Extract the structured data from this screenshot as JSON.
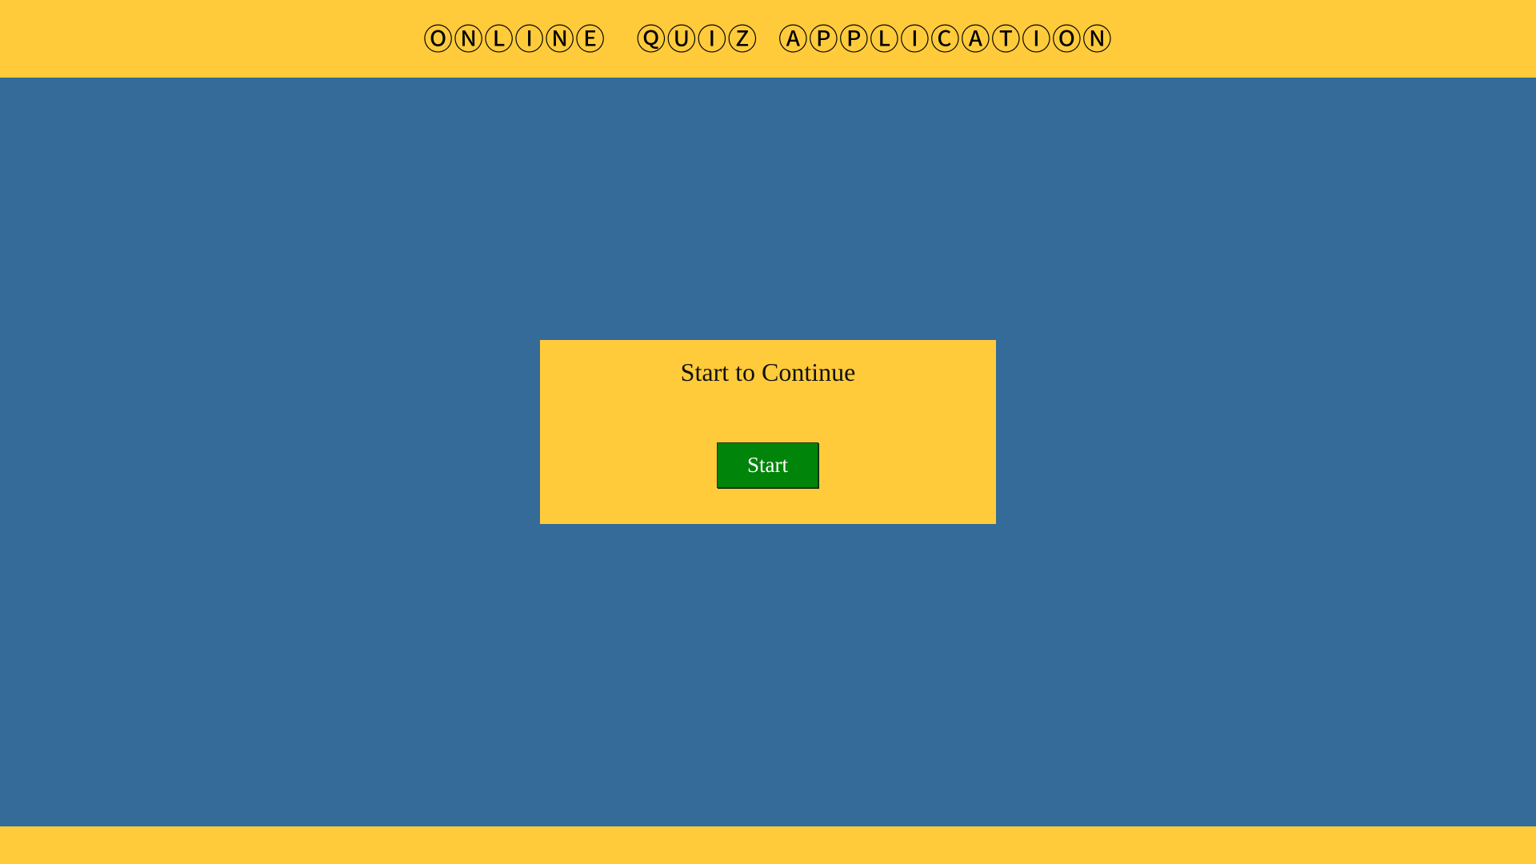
{
  "header": {
    "title": "ⓄⓃⓁⒾⓃⒺ   ⓆⓊⒾⓏ  ⒶⓅⓅⓁⒾⒸⒶⓉⒾⓄⓃ"
  },
  "card": {
    "title": "Start to Continue",
    "start_label": "Start"
  },
  "colors": {
    "header_bg": "#ffcb3b",
    "page_bg": "#356b98",
    "button_bg": "#00840a",
    "button_text": "#ffffff"
  }
}
